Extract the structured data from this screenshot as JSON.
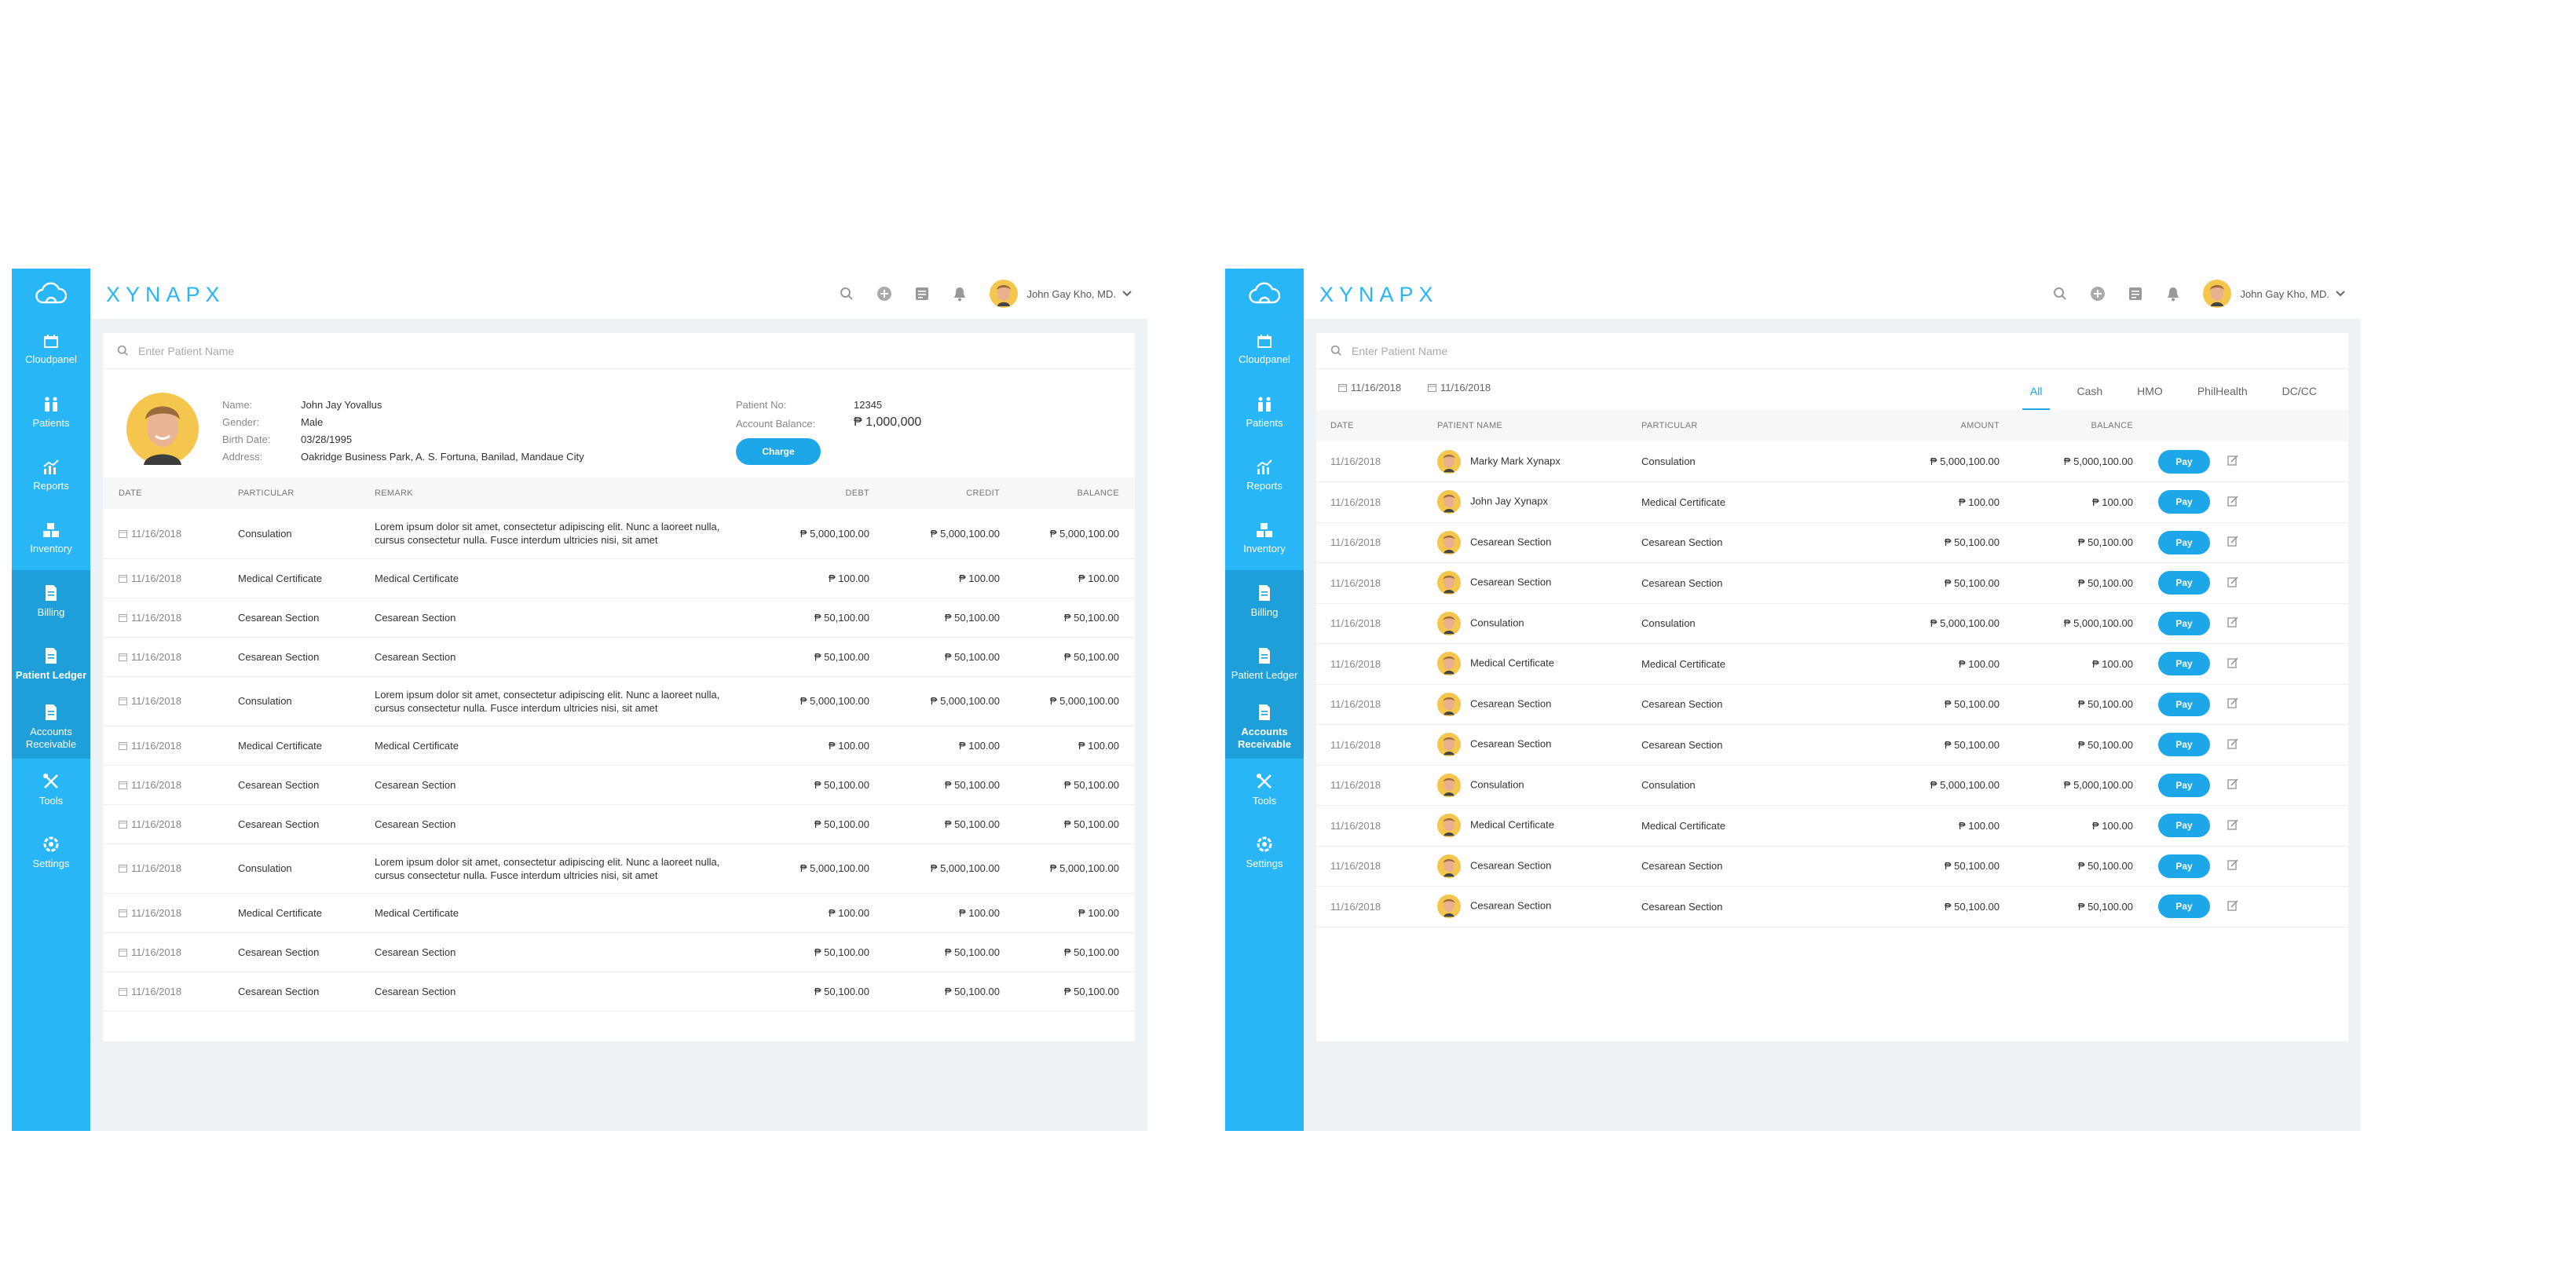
{
  "brand": "XYNAPX",
  "user": {
    "name": "John Gay Kho, MD."
  },
  "search": {
    "placeholder": "Enter Patient Name"
  },
  "sidebar": {
    "items": [
      {
        "label": "Cloudpanel",
        "icon": "cloudpanel-icon"
      },
      {
        "label": "Patients",
        "icon": "patients-icon"
      },
      {
        "label": "Reports",
        "icon": "reports-icon"
      },
      {
        "label": "Inventory",
        "icon": "inventory-icon"
      },
      {
        "label": "Billing",
        "icon": "billing-icon"
      },
      {
        "label": "Patient Ledger",
        "icon": "patient-ledger-icon"
      },
      {
        "label": "Accounts Receivable",
        "icon": "accounts-receivable-icon"
      },
      {
        "label": "Tools",
        "icon": "tools-icon"
      },
      {
        "label": "Settings",
        "icon": "settings-icon"
      }
    ]
  },
  "ledger": {
    "profile": {
      "name_label": "Name:",
      "name": "John Jay Yovallus",
      "gender_label": "Gender:",
      "gender": "Male",
      "birth_label": "Birth Date:",
      "birth": "03/28/1995",
      "address_label": "Address:",
      "address": "Oakridge Business Park, A. S. Fortuna, Banilad, Mandaue City",
      "patient_no_label": "Patient No:",
      "patient_no": "12345",
      "balance_label": "Account Balance:",
      "balance": "₱ 1,000,000",
      "charge_label": "Charge"
    },
    "columns": [
      "DATE",
      "PARTICULAR",
      "REMARK",
      "DEBT",
      "CREDIT",
      "BALANCE"
    ],
    "rows": [
      {
        "date": "11/16/2018",
        "particular": "Consulation",
        "remark": "Lorem ipsum dolor sit amet, consectetur adipiscing elit. Nunc a laoreet nulla, cursus consectetur nulla. Fusce interdum ultricies nisi, sit amet",
        "debt": "₱ 5,000,100.00",
        "credit": "₱ 5,000,100.00",
        "balance": "₱ 5,000,100.00"
      },
      {
        "date": "11/16/2018",
        "particular": "Medical Certificate",
        "remark": "Medical Certificate",
        "debt": "₱ 100.00",
        "credit": "₱ 100.00",
        "balance": "₱ 100.00"
      },
      {
        "date": "11/16/2018",
        "particular": "Cesarean Section",
        "remark": "Cesarean Section",
        "debt": "₱ 50,100.00",
        "credit": "₱ 50,100.00",
        "balance": "₱ 50,100.00"
      },
      {
        "date": "11/16/2018",
        "particular": "Cesarean Section",
        "remark": "Cesarean Section",
        "debt": "₱ 50,100.00",
        "credit": "₱ 50,100.00",
        "balance": "₱ 50,100.00"
      },
      {
        "date": "11/16/2018",
        "particular": "Consulation",
        "remark": "Lorem ipsum dolor sit amet, consectetur adipiscing elit. Nunc a laoreet nulla, cursus consectetur nulla. Fusce interdum ultricies nisi, sit amet",
        "debt": "₱ 5,000,100.00",
        "credit": "₱ 5,000,100.00",
        "balance": "₱ 5,000,100.00"
      },
      {
        "date": "11/16/2018",
        "particular": "Medical Certificate",
        "remark": "Medical Certificate",
        "debt": "₱ 100.00",
        "credit": "₱ 100.00",
        "balance": "₱ 100.00"
      },
      {
        "date": "11/16/2018",
        "particular": "Cesarean Section",
        "remark": "Cesarean Section",
        "debt": "₱ 50,100.00",
        "credit": "₱ 50,100.00",
        "balance": "₱ 50,100.00"
      },
      {
        "date": "11/16/2018",
        "particular": "Cesarean Section",
        "remark": "Cesarean Section",
        "debt": "₱ 50,100.00",
        "credit": "₱ 50,100.00",
        "balance": "₱ 50,100.00"
      },
      {
        "date": "11/16/2018",
        "particular": "Consulation",
        "remark": "Lorem ipsum dolor sit amet, consectetur adipiscing elit. Nunc a laoreet nulla, cursus consectetur nulla. Fusce interdum ultricies nisi, sit amet",
        "debt": "₱ 5,000,100.00",
        "credit": "₱ 5,000,100.00",
        "balance": "₱ 5,000,100.00"
      },
      {
        "date": "11/16/2018",
        "particular": "Medical Certificate",
        "remark": "Medical Certificate",
        "debt": "₱ 100.00",
        "credit": "₱ 100.00",
        "balance": "₱ 100.00"
      },
      {
        "date": "11/16/2018",
        "particular": "Cesarean Section",
        "remark": "Cesarean Section",
        "debt": "₱ 50,100.00",
        "credit": "₱ 50,100.00",
        "balance": "₱ 50,100.00"
      },
      {
        "date": "11/16/2018",
        "particular": "Cesarean Section",
        "remark": "Cesarean Section",
        "debt": "₱ 50,100.00",
        "credit": "₱ 50,100.00",
        "balance": "₱ 50,100.00"
      }
    ]
  },
  "receivable": {
    "date_from": "11/16/2018",
    "date_to": "11/16/2018",
    "tabs": [
      "All",
      "Cash",
      "HMO",
      "PhilHealth",
      "DC/CC"
    ],
    "active_tab": "All",
    "columns": [
      "DATE",
      "PATIENT NAME",
      "PARTICULAR",
      "AMOUNT",
      "BALANCE"
    ],
    "pay_label": "Pay",
    "rows": [
      {
        "date": "11/16/2018",
        "patient": "Marky Mark Xynapx",
        "particular": "Consulation",
        "amount": "₱ 5,000,100.00",
        "balance": "₱ 5,000,100.00"
      },
      {
        "date": "11/16/2018",
        "patient": "John Jay Xynapx",
        "particular": "Medical Certificate",
        "amount": "₱ 100.00",
        "balance": "₱ 100.00"
      },
      {
        "date": "11/16/2018",
        "patient": "Cesarean Section",
        "particular": "Cesarean Section",
        "amount": "₱ 50,100.00",
        "balance": "₱ 50,100.00"
      },
      {
        "date": "11/16/2018",
        "patient": "Cesarean Section",
        "particular": "Cesarean Section",
        "amount": "₱ 50,100.00",
        "balance": "₱ 50,100.00"
      },
      {
        "date": "11/16/2018",
        "patient": "Consulation",
        "particular": "Consulation",
        "amount": "₱ 5,000,100.00",
        "balance": "₱ 5,000,100.00"
      },
      {
        "date": "11/16/2018",
        "patient": "Medical Certificate",
        "particular": "Medical Certificate",
        "amount": "₱ 100.00",
        "balance": "₱ 100.00"
      },
      {
        "date": "11/16/2018",
        "patient": "Cesarean Section",
        "particular": "Cesarean Section",
        "amount": "₱ 50,100.00",
        "balance": "₱ 50,100.00"
      },
      {
        "date": "11/16/2018",
        "patient": "Cesarean Section",
        "particular": "Cesarean Section",
        "amount": "₱ 50,100.00",
        "balance": "₱ 50,100.00"
      },
      {
        "date": "11/16/2018",
        "patient": "Consulation",
        "particular": "Consulation",
        "amount": "₱ 5,000,100.00",
        "balance": "₱ 5,000,100.00"
      },
      {
        "date": "11/16/2018",
        "patient": "Medical Certificate",
        "particular": "Medical Certificate",
        "amount": "₱ 100.00",
        "balance": "₱ 100.00"
      },
      {
        "date": "11/16/2018",
        "patient": "Cesarean Section",
        "particular": "Cesarean Section",
        "amount": "₱ 50,100.00",
        "balance": "₱ 50,100.00"
      },
      {
        "date": "11/16/2018",
        "patient": "Cesarean Section",
        "particular": "Cesarean Section",
        "amount": "₱ 50,100.00",
        "balance": "₱ 50,100.00"
      }
    ]
  },
  "colors": {
    "accent": "#29b6f6",
    "button": "#1ea7e8",
    "background": "#ecf2f5"
  }
}
